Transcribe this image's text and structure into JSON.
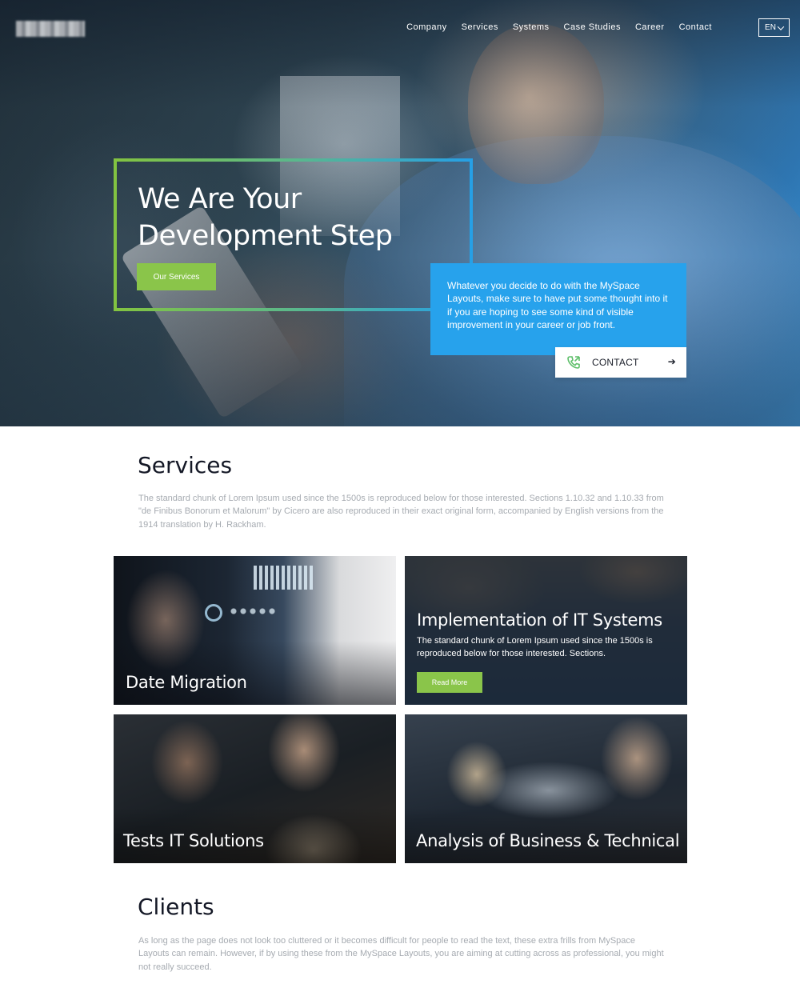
{
  "header": {
    "nav_items": [
      "Company",
      "Services",
      "Systems",
      "Case Studies",
      "Career",
      "Contact"
    ],
    "language": "EN"
  },
  "hero": {
    "headline": "We Are Your Development Step",
    "services_button": "Our Services",
    "info_text": "Whatever you decide to do with the MySpace Layouts, make sure to have put some thought into it if you are hoping to see some kind of visible improvement in your career or job front.",
    "contact_button": "CONTACT",
    "accent_color": "#8ac54a",
    "info_box_color": "#27a2ec"
  },
  "services": {
    "title": "Services",
    "text": "The standard chunk of Lorem Ipsum used since the 1500s is reproduced below for those interested. Sections 1.10.32 and 1.10.33 from \"de Finibus Bonorum et Malorum\" by Cicero are also reproduced in their exact original form, accompanied by English versions from the 1914 translation by H. Rackham.",
    "cards": [
      {
        "title": "Date Migration"
      },
      {
        "title": "Implementation of IT Systems",
        "description": "The standard chunk of Lorem Ipsum used since the 1500s is reproduced below for those interested. Sections.",
        "button": "Read More"
      },
      {
        "title": "Tests IT Solutions"
      },
      {
        "title": "Analysis of Business & Technical"
      }
    ]
  },
  "clients": {
    "title": "Clients",
    "text": "As long as the page does not look too cluttered or it becomes difficult for people to read the text, these extra frills from MySpace Layouts can remain. However, if by using these from the MySpace Layouts, you are aiming at cutting across as professional, you might not really succeed."
  }
}
